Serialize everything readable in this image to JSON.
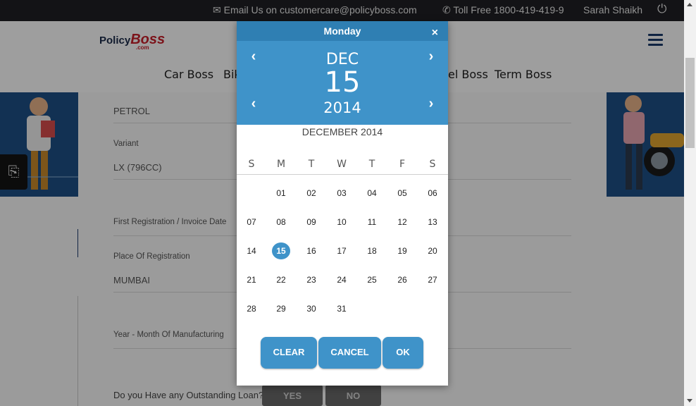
{
  "topbar": {
    "email_text": "Email Us on customercare@policyboss.com",
    "toll_text": "Toll Free 1800-419-419-9",
    "user_name": "Sarah Shaikh",
    "power_icon": "⏻",
    "email_icon": "✉",
    "phone_icon": "📞"
  },
  "logo": {
    "policy": "Policy",
    "boss": "Boss",
    "com": ".com"
  },
  "nav": {
    "car": "Car Boss",
    "bike": "Bik",
    "travel": "el Boss",
    "term": "Term Boss"
  },
  "form": {
    "fuel_value": "PETROL",
    "variant_label": "Variant",
    "variant_value": "LX (796CC)",
    "reg_date_label": "First Registration / Invoice Date",
    "place_label": "Place Of Registration",
    "place_value": "MUMBAI",
    "mfg_label": "Year - Month Of Manufacturing",
    "loan_question": "Do you Have any Outstanding Loan?",
    "yes_label": "YES",
    "no_label": "NO"
  },
  "picker": {
    "day_name": "Monday",
    "close_label": "×",
    "month": "DEC",
    "day": "15",
    "year": "2014",
    "prev_arrow": "‹",
    "next_arrow": "›",
    "calendar_title": "DECEMBER 2014",
    "weekdays": [
      "S",
      "M",
      "T",
      "W",
      "T",
      "F",
      "S"
    ],
    "weeks": [
      [
        "",
        "01",
        "02",
        "03",
        "04",
        "05",
        "06"
      ],
      [
        "07",
        "08",
        "09",
        "10",
        "11",
        "12",
        "13"
      ],
      [
        "14",
        "15",
        "16",
        "17",
        "18",
        "19",
        "20"
      ],
      [
        "21",
        "22",
        "23",
        "24",
        "25",
        "26",
        "27"
      ],
      [
        "28",
        "29",
        "30",
        "31",
        "",
        "",
        ""
      ]
    ],
    "selected": "15",
    "clear_label": "CLEAR",
    "cancel_label": "CANCEL",
    "ok_label": "OK"
  },
  "colors": {
    "accent": "#3f93c9",
    "header_dark": "#2f7fb3",
    "brand_red": "#c8202b"
  }
}
